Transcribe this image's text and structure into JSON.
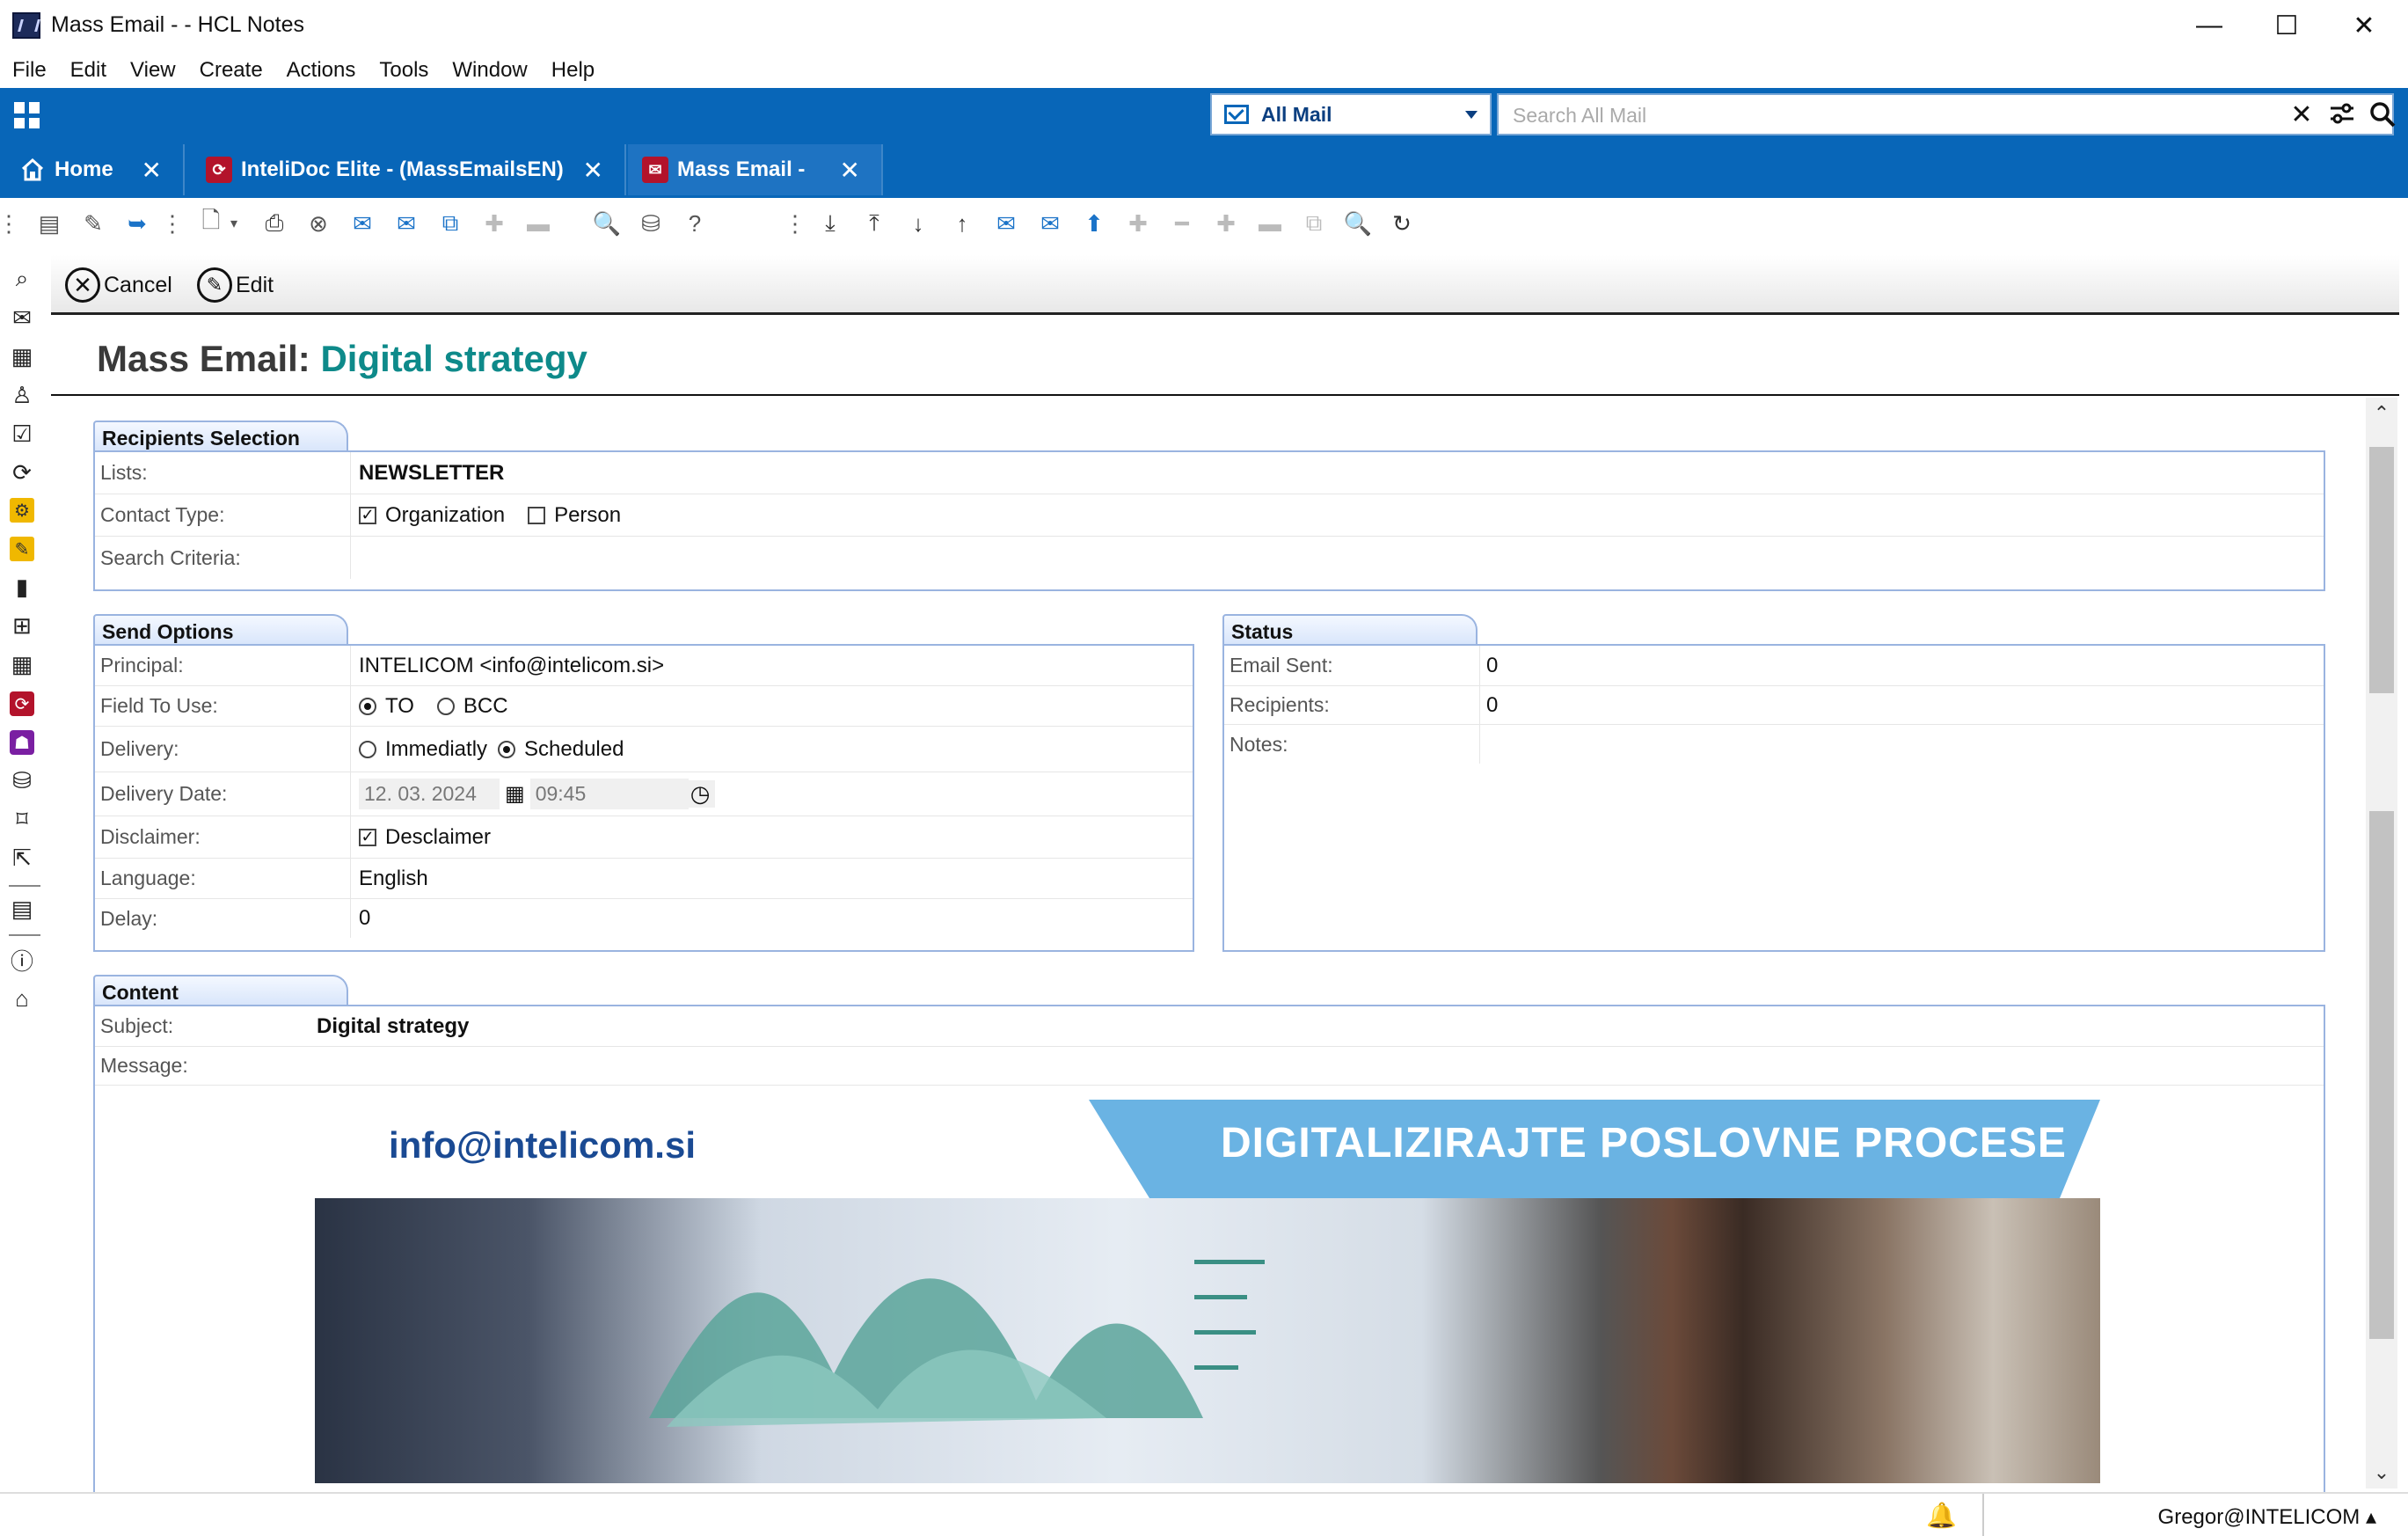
{
  "window": {
    "title": "Mass Email -  - HCL Notes",
    "minimize": "—",
    "maximize": "☐",
    "close": "✕"
  },
  "menu": [
    "File",
    "Edit",
    "View",
    "Create",
    "Actions",
    "Tools",
    "Window",
    "Help"
  ],
  "header": {
    "mail_select": "All Mail",
    "search_placeholder": "Search All Mail"
  },
  "tabs": [
    {
      "label": "Home",
      "close": "✕"
    },
    {
      "label": "InteliDoc Elite - (MassEmailsEN)",
      "close": "✕"
    },
    {
      "label": "Mass Email -",
      "close": "✕"
    }
  ],
  "actions": {
    "cancel": "Cancel",
    "edit": "Edit"
  },
  "document": {
    "title_prefix": "Mass Email:",
    "title_name": "Digital strategy"
  },
  "recipients": {
    "section": "Recipients Selection",
    "lists_label": "Lists:",
    "lists_value": "NEWSLETTER",
    "contact_type_label": "Contact Type:",
    "contact_org": "Organization",
    "contact_person": "Person",
    "search_label": "Search Criteria:"
  },
  "send_options": {
    "section": "Send Options",
    "principal_label": "Principal:",
    "principal_value": "INTELICOM <info@intelicom.si>",
    "field_label": "Field To Use:",
    "field_to": "TO",
    "field_bcc": "BCC",
    "delivery_label": "Delivery:",
    "delivery_immediately": "Immediatly",
    "delivery_scheduled": "Scheduled",
    "delivery_date_label": "Delivery Date:",
    "delivery_date": "12. 03. 2024",
    "delivery_time": "09:45",
    "disclaimer_label": "Disclaimer:",
    "disclaimer_value": "Desclaimer",
    "language_label": "Language:",
    "language_value": "English",
    "delay_label": "Delay:",
    "delay_value": "0"
  },
  "status": {
    "section": "Status",
    "sent_label": "Email Sent:",
    "sent_value": "0",
    "recipients_label": "Recipients:",
    "recipients_value": "0",
    "notes_label": "Notes:"
  },
  "content": {
    "section": "Content",
    "subject_label": "Subject:",
    "subject_value": "Digital strategy",
    "message_label": "Message:",
    "banner_email": "info@intelicom.si",
    "banner_slogan": "DIGITALIZIRAJTE POSLOVNE PROCESE"
  },
  "statusbar": {
    "user": "Gregor@INTELICOM ▴"
  },
  "colors": {
    "brand_blue": "#0866b8",
    "accent_teal": "#0e8a8a",
    "section_border": "#9ab4e0"
  }
}
